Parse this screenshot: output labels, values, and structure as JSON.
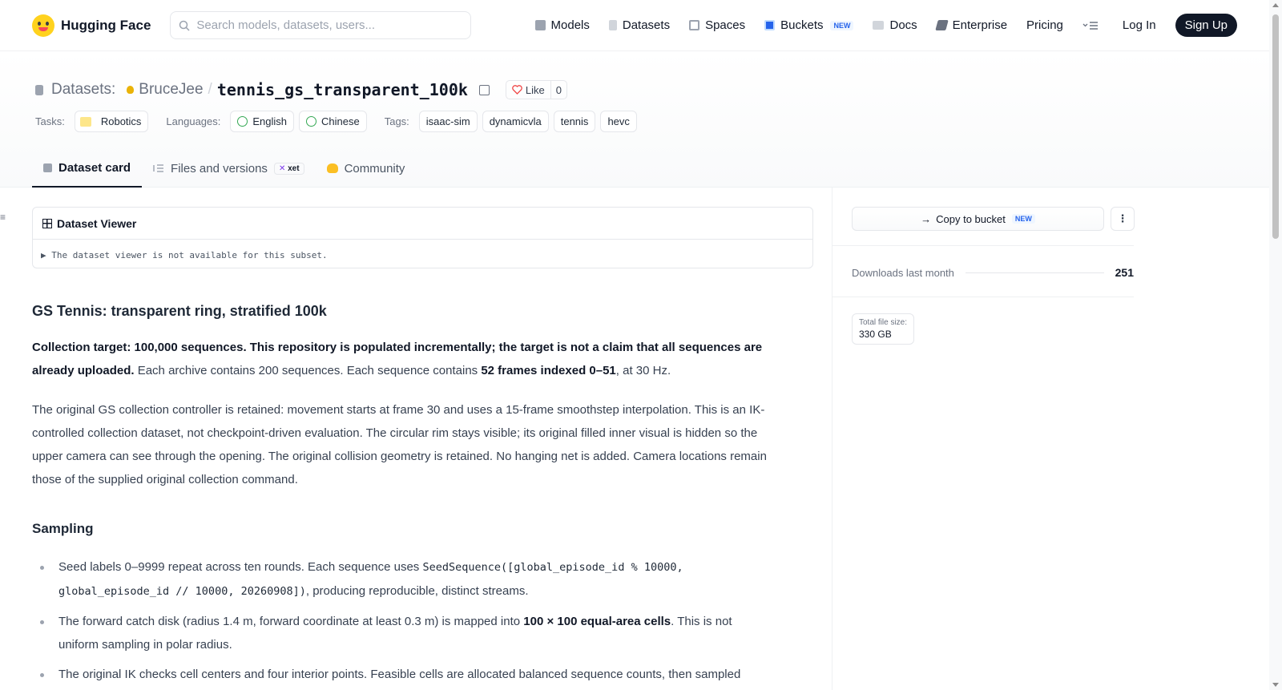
{
  "nav": {
    "brand": "Hugging Face",
    "search_placeholder": "Search models, datasets, users...",
    "links": [
      {
        "label": "Models",
        "icon": "cube-icon"
      },
      {
        "label": "Datasets",
        "icon": "database-icon"
      },
      {
        "label": "Spaces",
        "icon": "grid-icon"
      },
      {
        "label": "Buckets",
        "icon": "bucket-icon",
        "badge": "NEW"
      },
      {
        "label": "Docs",
        "icon": "book-icon"
      },
      {
        "label": "Enterprise",
        "icon": "enterprise-icon"
      },
      {
        "label": "Pricing"
      }
    ],
    "login": "Log In",
    "signup": "Sign Up"
  },
  "repo": {
    "section": "Datasets:",
    "owner": "BruceJee",
    "name": "tennis_gs_transparent_100k",
    "like_label": "Like",
    "like_count": "0"
  },
  "tags": {
    "tasks_label": "Tasks:",
    "tasks": [
      "Robotics"
    ],
    "languages_label": "Languages:",
    "languages": [
      "English",
      "Chinese"
    ],
    "tags_label": "Tags:",
    "tags": [
      "isaac-sim",
      "dynamicvla",
      "tennis",
      "hevc"
    ]
  },
  "tabs": {
    "card": "Dataset card",
    "files": "Files and versions",
    "files_badge": "xet",
    "community": "Community"
  },
  "viewer": {
    "title": "Dataset Viewer",
    "message": "The dataset viewer is not available for this subset."
  },
  "card": {
    "title": "GS Tennis: transparent ring, stratified 100k",
    "p1_bold": "Collection target: 100,000 sequences. This repository is populated incrementally; the target is not a claim that all sequences are already uploaded.",
    "p1_mid": " Each archive contains 200 sequences. Each sequence contains ",
    "p1_bold2": "52 frames indexed 0–51",
    "p1_end": ", at 30 Hz.",
    "p2": "The original GS collection controller is retained: movement starts at frame 30 and uses a 15-frame smoothstep interpolation. This is an IK-controlled collection dataset, not checkpoint-driven evaluation. The circular rim stays visible; its original filled inner visual is hidden so the upper camera can see through the opening. The original collision geometry is retained. No hanging net is added. Camera locations remain those of the supplied original collection command.",
    "sampling_heading": "Sampling",
    "b1_a": "Seed labels 0–9999 repeat across ten rounds. Each sequence uses ",
    "b1_code": "SeedSequence([global_episode_id % 10000, global_episode_id // 10000, 20260908])",
    "b1_b": ", producing reproducible, distinct streams.",
    "b2_a": "The forward catch disk (radius 1.4 m, forward coordinate at least 0.3 m) is mapped into ",
    "b2_bold": "100 × 100 equal-area cells",
    "b2_b": ". This is not uniform sampling in polar radius.",
    "b3": "The original IK checks cell centers and four interior points. Feasible cells are allocated balanced sequence counts, then sampled"
  },
  "sidebar": {
    "bucket_label": "Copy to bucket",
    "bucket_badge": "NEW",
    "downloads_label": "Downloads last month",
    "downloads_value": "251",
    "size_label": "Total file size:",
    "size_value": "330 GB"
  }
}
